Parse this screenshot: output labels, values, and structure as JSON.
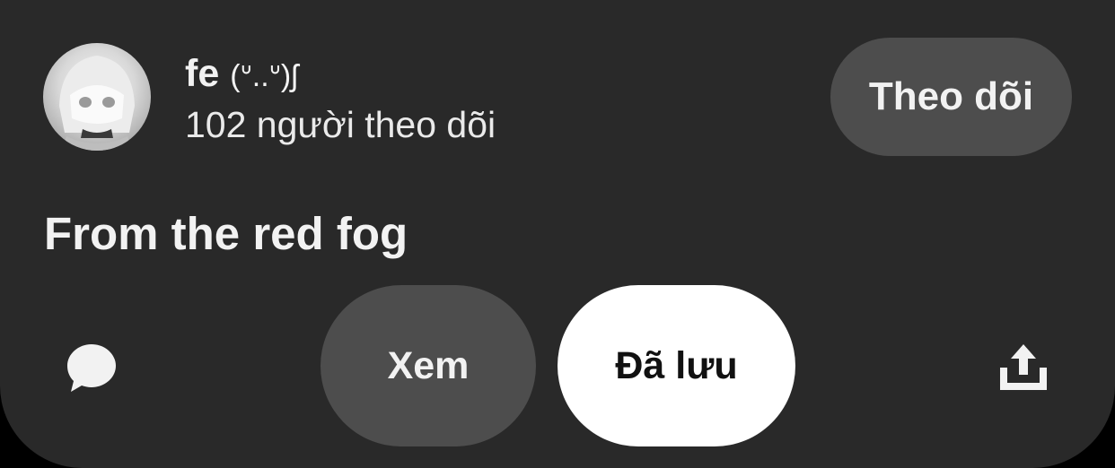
{
  "creator": {
    "name": "fe",
    "kaomoji": "(ᐡ..ᐡ)ʃ",
    "followers": "102 người theo dõi",
    "avatar_icon": "avatar"
  },
  "actions": {
    "follow_label": "Theo dõi",
    "view_label": "Xem",
    "saved_label": "Đã lưu",
    "comment_icon": "comment-icon",
    "share_icon": "share-icon"
  },
  "pin": {
    "title": "From the red fog"
  },
  "colors": {
    "panel_bg": "#292929",
    "secondary_button": "#4d4d4d",
    "primary_button": "#ffffff",
    "text": "#f2f2f2"
  }
}
